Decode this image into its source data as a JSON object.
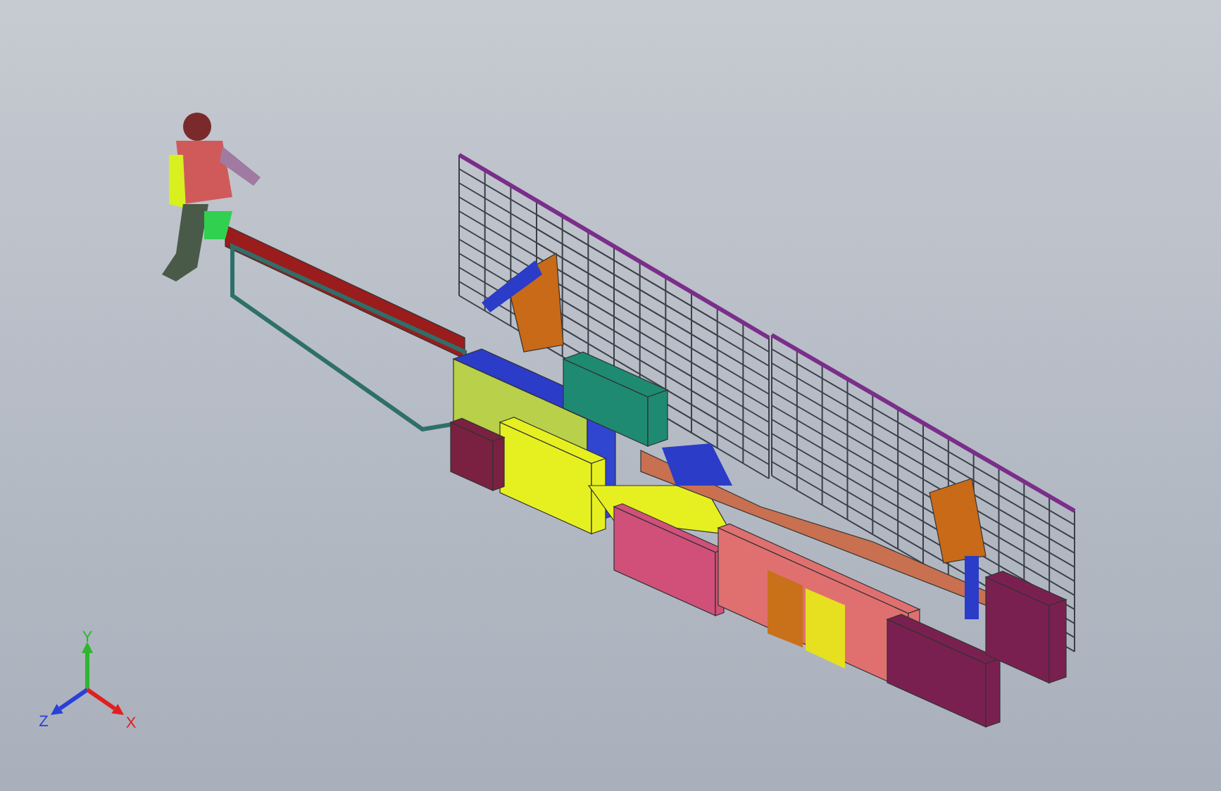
{
  "viewport": {
    "triad": {
      "axes": [
        {
          "label": "Y",
          "color": "#2fb52f",
          "kind": "up"
        },
        {
          "label": "Z",
          "color": "#2a3fd8",
          "kind": "left"
        },
        {
          "label": "X",
          "color": "#e02020",
          "kind": "right"
        }
      ]
    }
  }
}
